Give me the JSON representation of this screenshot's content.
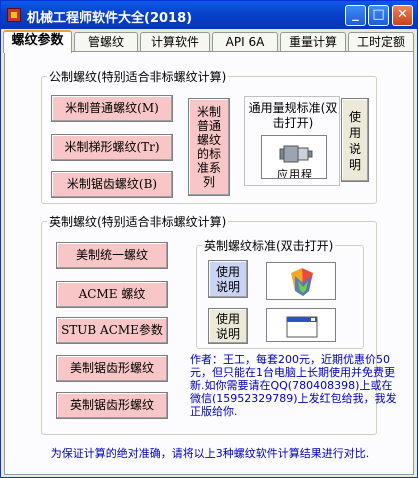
{
  "window": {
    "title": "机械工程师软件大全(2018)"
  },
  "tabs": [
    {
      "label": "螺纹参数"
    },
    {
      "label": "管螺纹"
    },
    {
      "label": "计算软件"
    },
    {
      "label": "API 6A"
    },
    {
      "label": "重量计算"
    },
    {
      "label": "工时定额"
    }
  ],
  "metric_group": {
    "legend": "公制螺纹(特别适合非标螺纹计算)",
    "buttons": [
      "米制普通螺纹(M)",
      "米制梯形螺纹(Tr)",
      "米制锯齿螺纹(B)"
    ],
    "series_button": "米制普通螺纹的标准系列",
    "gauge_label": "通用量规标准(双击打开)",
    "gauge_caption": "应用程",
    "usage_button": "使用说明"
  },
  "imperial_group": {
    "legend": "英制螺纹(特别适合非标螺纹计算)",
    "buttons": [
      "美制统一螺纹",
      "ACME 螺纹",
      "STUB ACME参数",
      "美制锯齿形螺纹",
      "英制锯齿形螺纹"
    ],
    "standard_legend": "英制螺纹标准(双击打开)",
    "usage_button_1": "使用说明",
    "usage_button_2": "使用说明"
  },
  "author_text": "作者：王工，每套200元，近期优惠价50元，但只能在1台电脑上长期使用并免费更新.如你需要请在QQ(780408398)上或在微信(15952329789)上发红包给我，我发正版给你.",
  "footer": "为保证计算的绝对准确，请将以上3种螺纹软件计算结果进行对比.",
  "colors": {
    "title_bar": "#0842c8",
    "pink_button": "#f8c6c6",
    "blue_button": "#c9d4f5",
    "note_text": "#0000c0",
    "active_tab_accent": "#f0a030"
  }
}
